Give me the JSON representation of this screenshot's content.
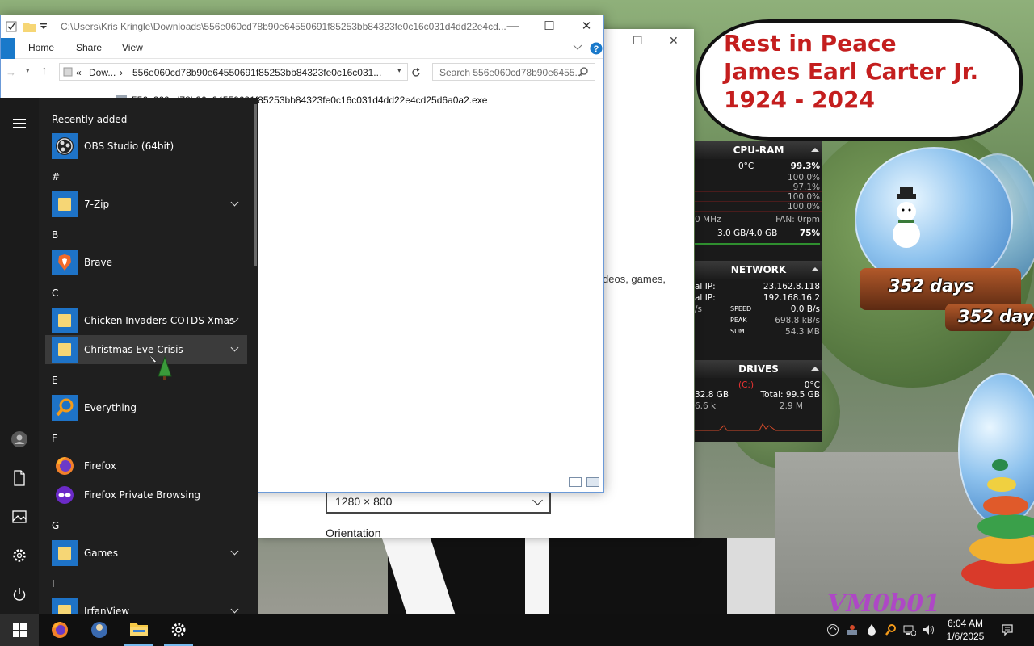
{
  "wallpaper": {
    "banner_lines": [
      "Rest in Peace",
      "James Earl Carter Jr.",
      "1924 - 2024"
    ],
    "countdown_1": "352 days",
    "countdown_2": "352 days",
    "watermark": "VM0b01"
  },
  "sysmon": {
    "cpu": {
      "title": "CPU-RAM",
      "temp": "0°C",
      "total": "99.3%",
      "cores": [
        "100.0%",
        "97.1%",
        "100.0%",
        "100.0%"
      ],
      "clock": "0 MHz",
      "fan": "FAN: 0rpm",
      "ram": "3.0 GB/4.0 GB",
      "ram_pct": "75%"
    },
    "network": {
      "title": "NETWORK",
      "ext_ip_label": "al IP:",
      "ext_ip": "23.162.8.118",
      "int_ip_label": "al IP:",
      "int_ip": "192.168.16.2",
      "speed_label": "SPEED",
      "speed": "0.0 B/s",
      "speed_unit": "/s",
      "peak_label": "PEAK",
      "peak": "698.8 kB/s",
      "sum_label": "SUM",
      "sum": "54.3 MB"
    },
    "drives": {
      "title": "DRIVES",
      "drive": "(C:)",
      "temp": "0°C",
      "free": "32.8 GB",
      "total": "Total: 99.5 GB",
      "read": "6.6 k",
      "write": "2.9 M"
    }
  },
  "settings": {
    "resolution": "1280 × 800",
    "orientation_label": "Orientation",
    "snippet": "deos, games,"
  },
  "explorer": {
    "title_path": "C:\\Users\\Kris Kringle\\Downloads\\556e060cd78b90e64550691f85253bb84323fe0c16c031d4dd22e4cd...",
    "ribbon_tabs": [
      "Home",
      "Share",
      "View"
    ],
    "address_parts": [
      "«",
      "Dow...",
      "›",
      "556e060cd78b90e64550691f85253bb84323fe0c16c031..."
    ],
    "search_placeholder": "Search 556e060cd78b90e6455...",
    "file_name": "556e060cd78b90e64550691f85253bb84323fe0c16c031d4dd22e4cd25d6a0a2.exe"
  },
  "startmenu": {
    "entries": [
      {
        "kind": "head",
        "text": "Recently added"
      },
      {
        "kind": "app",
        "label": "OBS Studio (64bit)",
        "icon": "obs-icon",
        "chevron": false
      },
      {
        "kind": "head",
        "text": "#"
      },
      {
        "kind": "app",
        "label": "7-Zip",
        "icon": "folder-icon",
        "chevron": true
      },
      {
        "kind": "head",
        "text": "B"
      },
      {
        "kind": "app",
        "label": "Brave",
        "icon": "brave-icon",
        "chevron": false
      },
      {
        "kind": "head",
        "text": "C"
      },
      {
        "kind": "app",
        "label": "Chicken Invaders COTDS Xmas",
        "icon": "folder-icon",
        "chevron": true
      },
      {
        "kind": "app",
        "label": "Christmas Eve Crisis",
        "icon": "folder-icon",
        "chevron": true,
        "hover": true
      },
      {
        "kind": "head",
        "text": "E"
      },
      {
        "kind": "app",
        "label": "Everything",
        "icon": "everything-icon",
        "chevron": false
      },
      {
        "kind": "head",
        "text": "F"
      },
      {
        "kind": "app",
        "label": "Firefox",
        "icon": "firefox-icon",
        "chevron": false
      },
      {
        "kind": "app",
        "label": "Firefox Private Browsing",
        "icon": "firefox-private-icon",
        "chevron": false
      },
      {
        "kind": "head",
        "text": "G"
      },
      {
        "kind": "app",
        "label": "Games",
        "icon": "folder-icon",
        "chevron": true
      },
      {
        "kind": "head",
        "text": "I"
      },
      {
        "kind": "app",
        "label": "IrfanView",
        "icon": "folder-icon",
        "chevron": true
      }
    ]
  },
  "taskbar": {
    "time": "6:04 AM",
    "date": "1/6/2025"
  }
}
